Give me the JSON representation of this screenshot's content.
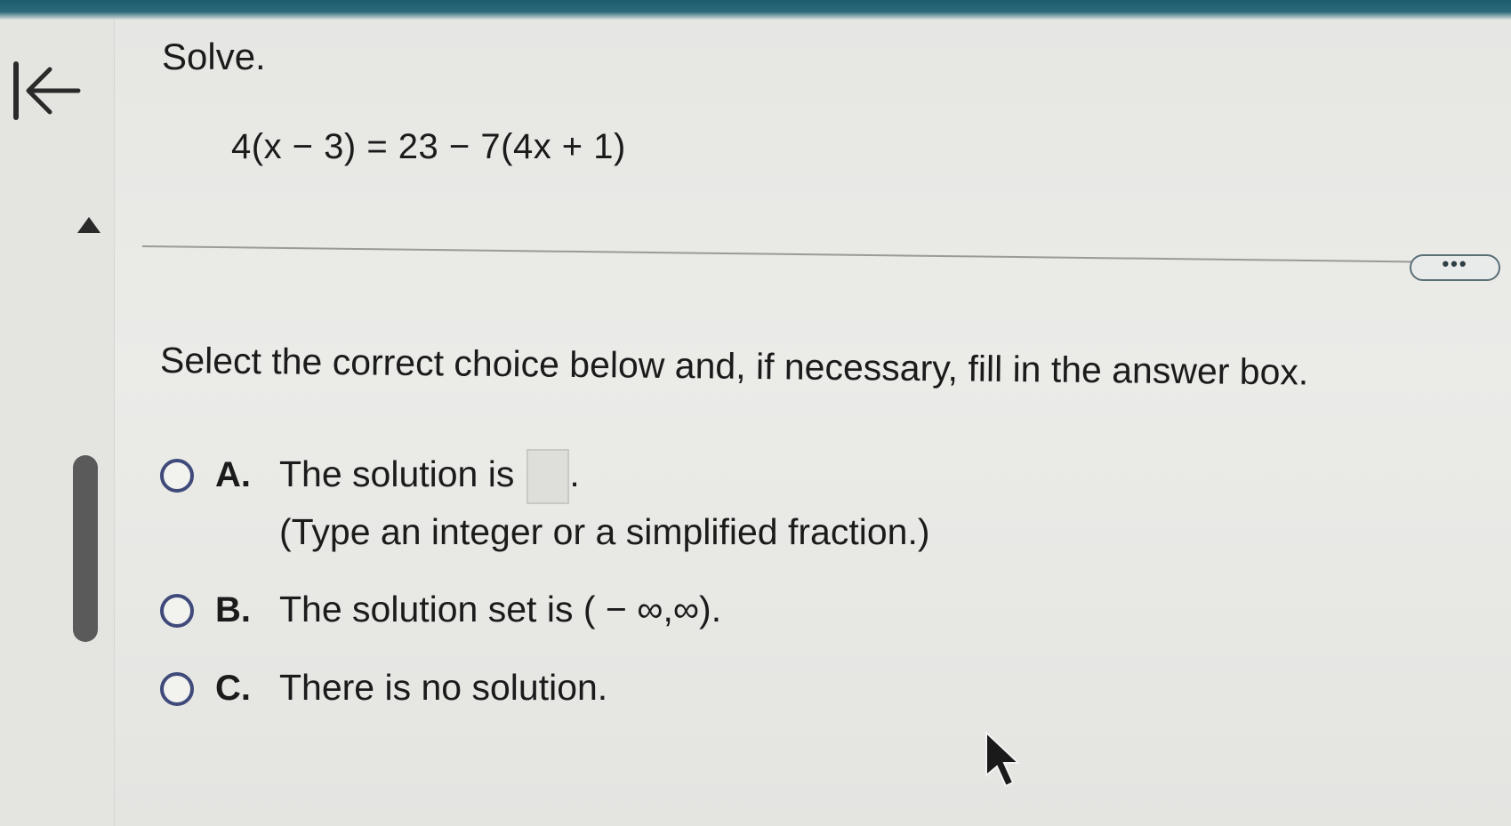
{
  "question": {
    "title": "Solve.",
    "equation": "4(x − 3) = 23 − 7(4x + 1)",
    "more_label": "•••"
  },
  "instruction": "Select the correct choice below and, if necessary, fill in the answer box.",
  "choices": [
    {
      "letter": "A.",
      "text": "The solution is",
      "suffix": ".",
      "hint": "(Type an integer or a simplified fraction.)",
      "answer_value": ""
    },
    {
      "letter": "B.",
      "text": "The solution set is ( − ∞,∞)."
    },
    {
      "letter": "C.",
      "text": "There is no solution."
    }
  ],
  "icons": {
    "back": "back-to-start-icon",
    "collapse": "triangle-up-icon",
    "cursor": "mouse-pointer-icon"
  },
  "colors": {
    "header": "#1d5c6e",
    "radio_border": "#3f4a7a"
  }
}
